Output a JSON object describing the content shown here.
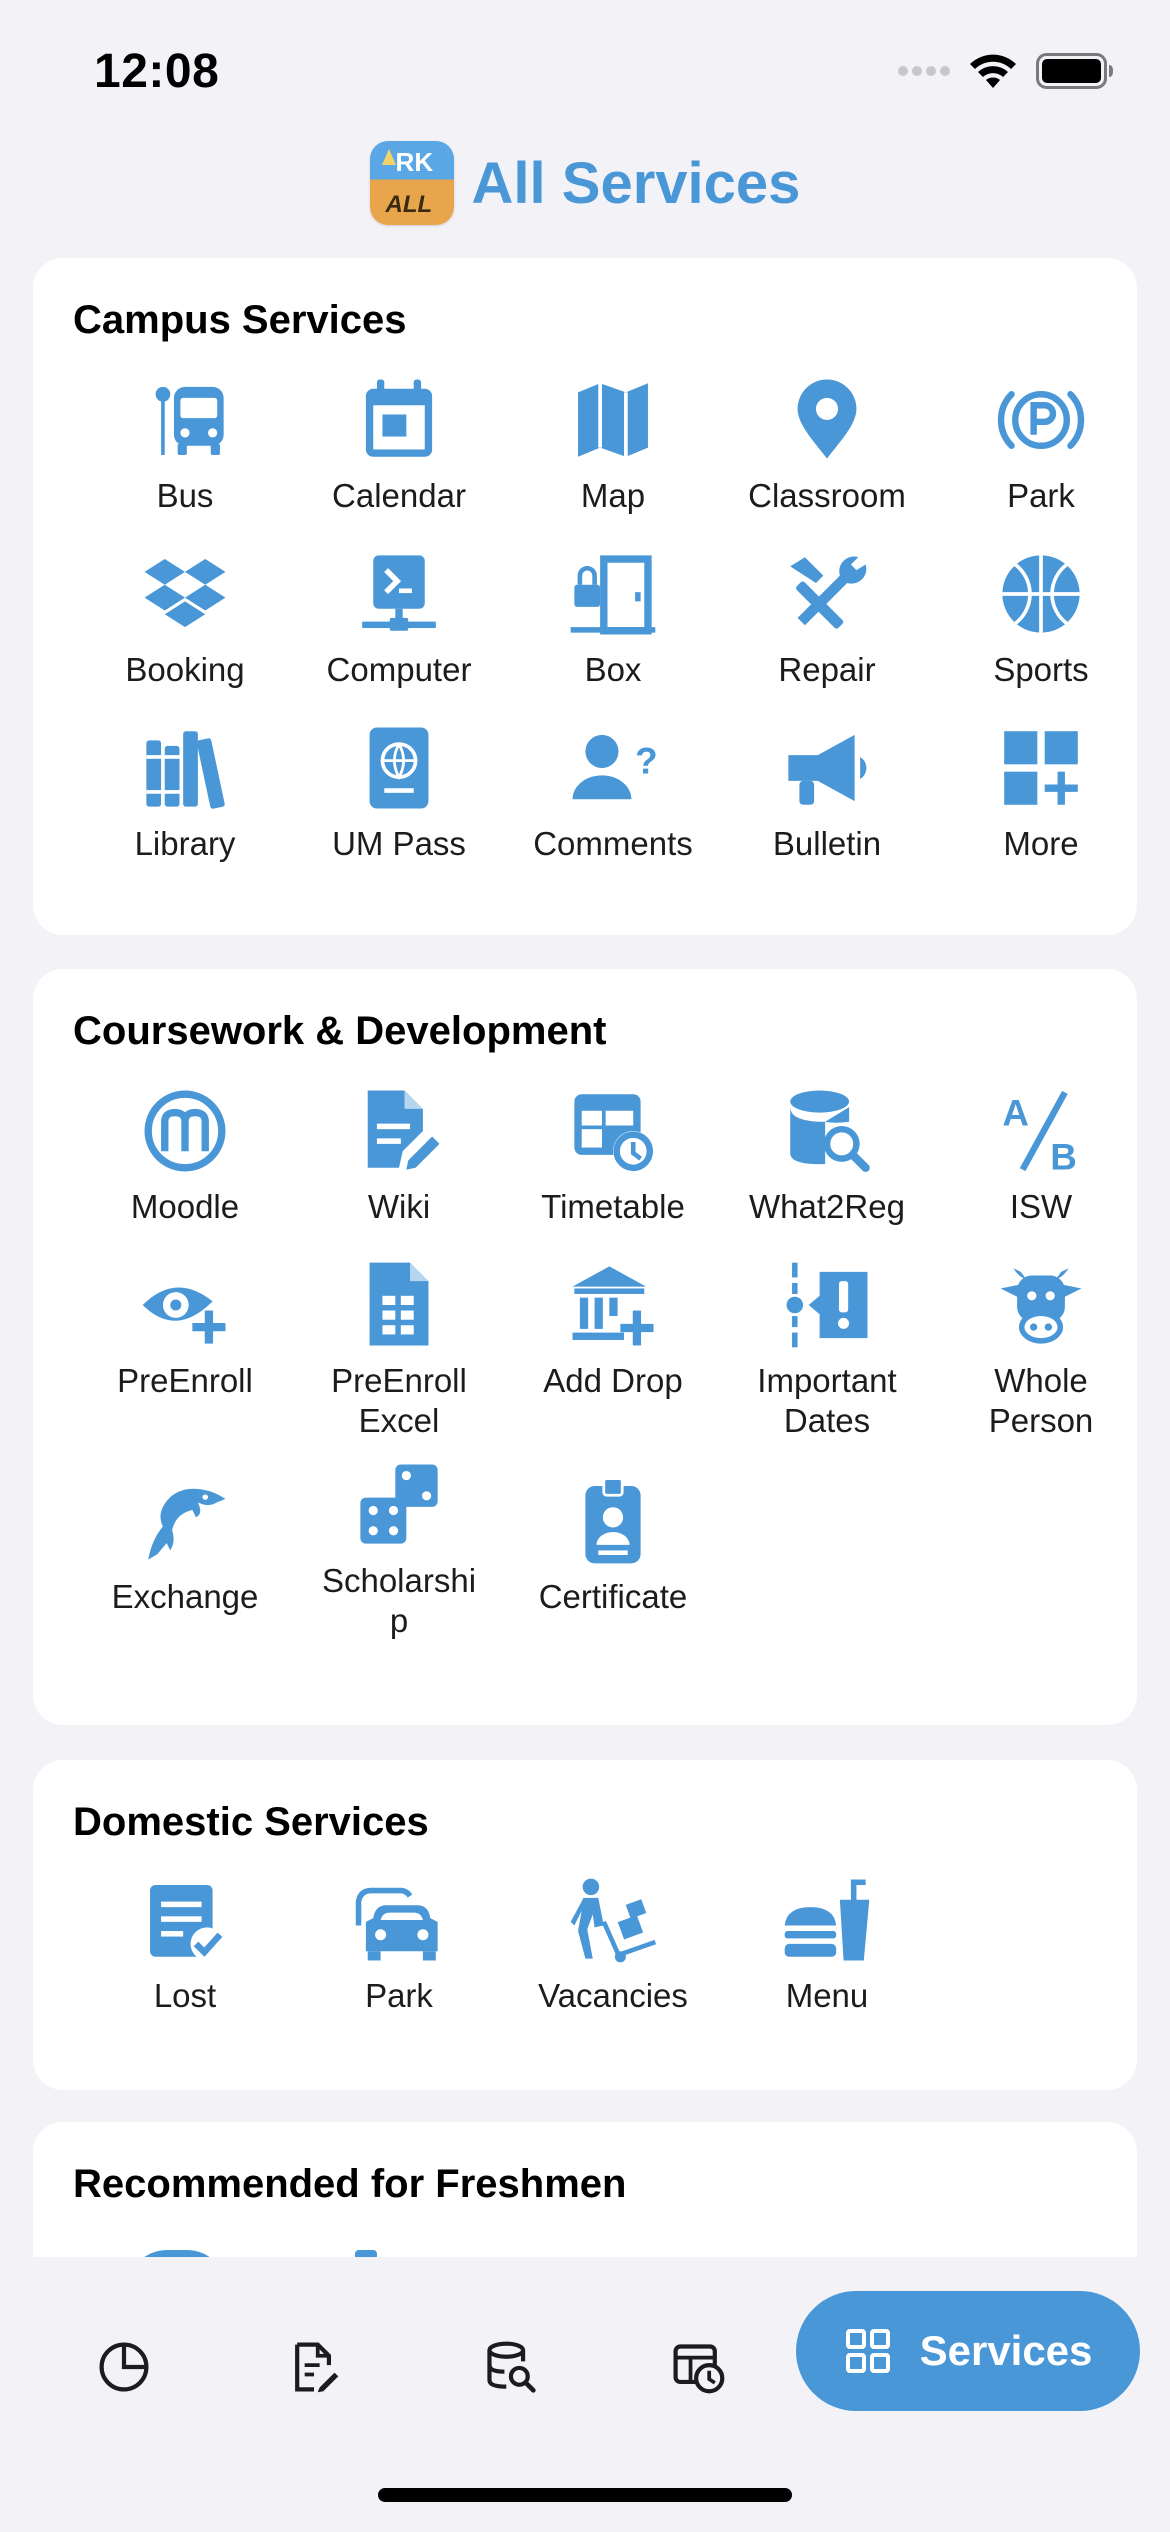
{
  "status_bar": {
    "time": "12:08"
  },
  "header": {
    "title": "All Services",
    "logo_text_top": "RK",
    "logo_text_bottom": "ALL"
  },
  "colors": {
    "accent": "#4a97d8",
    "background": "#f2f2f7",
    "card": "#ffffff"
  },
  "sections": [
    {
      "title": "Campus Services",
      "items": [
        {
          "label": "Bus",
          "icon": "bus-icon"
        },
        {
          "label": "Calendar",
          "icon": "calendar-icon"
        },
        {
          "label": "Map",
          "icon": "map-icon"
        },
        {
          "label": "Classroom",
          "icon": "location-pin-icon"
        },
        {
          "label": "Park",
          "icon": "parking-icon"
        },
        {
          "label": "Booking",
          "icon": "dropbox-icon"
        },
        {
          "label": "Computer",
          "icon": "computer-network-icon"
        },
        {
          "label": "Box",
          "icon": "locker-door-icon"
        },
        {
          "label": "Repair",
          "icon": "tools-icon"
        },
        {
          "label": "Sports",
          "icon": "basketball-icon"
        },
        {
          "label": "Library",
          "icon": "books-icon"
        },
        {
          "label": "UM Pass",
          "icon": "passport-icon"
        },
        {
          "label": "Comments",
          "icon": "user-question-icon"
        },
        {
          "label": "Bulletin",
          "icon": "megaphone-icon"
        },
        {
          "label": "More",
          "icon": "grid-plus-icon"
        }
      ]
    },
    {
      "title": "Coursework & Development",
      "items": [
        {
          "label": "Moodle",
          "icon": "moodle-icon"
        },
        {
          "label": "Wiki",
          "icon": "file-edit-icon"
        },
        {
          "label": "Timetable",
          "icon": "table-clock-icon"
        },
        {
          "label": "What2Reg",
          "icon": "database-search-icon"
        },
        {
          "label": "ISW",
          "icon": "a-slash-b-icon"
        },
        {
          "label": "PreEnroll",
          "icon": "eye-plus-icon"
        },
        {
          "label": "PreEnroll\nExcel",
          "icon": "spreadsheet-file-icon"
        },
        {
          "label": "Add Drop",
          "icon": "bank-plus-icon"
        },
        {
          "label": "Important\nDates",
          "icon": "timeline-alert-icon"
        },
        {
          "label": "Whole\nPerson",
          "icon": "cow-icon"
        },
        {
          "label": "Exchange",
          "icon": "dolphin-icon"
        },
        {
          "label": "Scholarshi\np",
          "icon": "dice-icon"
        },
        {
          "label": "Certificate",
          "icon": "id-badge-icon"
        }
      ]
    },
    {
      "title": "Domestic Services",
      "items": [
        {
          "label": "Lost",
          "icon": "note-check-icon"
        },
        {
          "label": "Park",
          "icon": "cars-icon"
        },
        {
          "label": "Vacancies",
          "icon": "person-dolly-icon"
        },
        {
          "label": "Menu",
          "icon": "burger-drink-icon"
        }
      ]
    },
    {
      "title": "Recommended for Freshmen",
      "items": []
    }
  ],
  "tabbar": {
    "tabs": [
      {
        "icon": "pie-chart-icon"
      },
      {
        "icon": "file-edit-icon"
      },
      {
        "icon": "database-search-icon"
      },
      {
        "icon": "table-clock-icon"
      }
    ],
    "active_label": "Services",
    "active_icon": "grid-icon"
  }
}
